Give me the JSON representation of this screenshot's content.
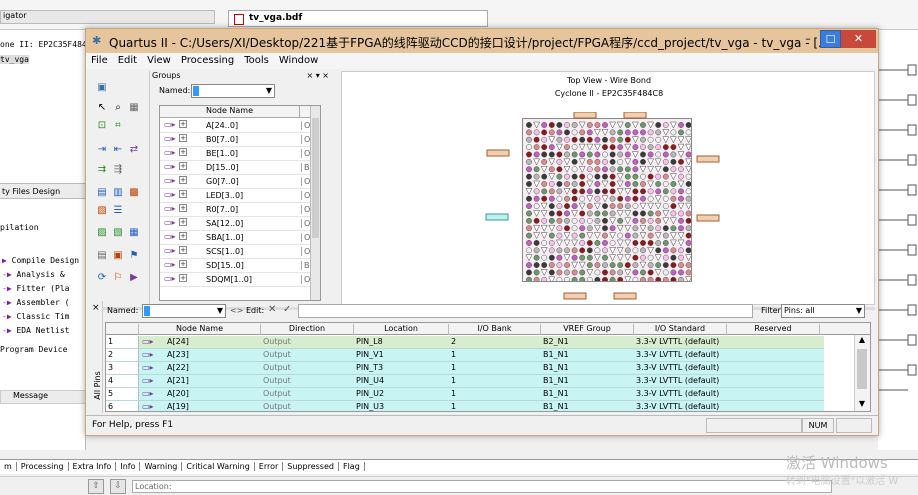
{
  "background": {
    "nav_header": "igator",
    "tab_file": "tv_vga.bdf",
    "hier_device": "one II: EP2C35F484",
    "hier_top": "tv_vga",
    "files_tab": "Files",
    "design_tab": "Design",
    "compilation": "pilation",
    "tasks": [
      "Compile Design",
      "Analysis &",
      "Fitter (Pla",
      "Assembler (",
      "Classic Tim",
      "EDA Netlist",
      "Program Device"
    ],
    "message_header": "Message",
    "bottom_tabs": [
      "m",
      "Processing",
      "Extra Info",
      "Info",
      "Warning",
      "Critical Warning",
      "Error",
      "Suppressed",
      "Flag"
    ],
    "location_label": "Location:",
    "watermark_line1": "激活 Windows",
    "watermark_line2": "转到\"电脑设置\"以激活 W"
  },
  "window": {
    "title": "Quartus II - C:/Users/XI/Desktop/221基于FPGA的线阵驱动CCD的接口设计/project/FPGA程序/ccd_project/tv_vga - tv_vga - [...",
    "min_label": "–",
    "max_label": "☐",
    "close_label": "✕",
    "menu": [
      "File",
      "Edit",
      "View",
      "Processing",
      "Tools",
      "Window"
    ]
  },
  "groups": {
    "header": "Groups",
    "header_buttons": "× ▾ ×",
    "named_label": "Named:",
    "column": "Node Name",
    "rows": [
      {
        "name": "A[24..0]",
        "dir": "Ou"
      },
      {
        "name": "B0[7..0]",
        "dir": "Ou"
      },
      {
        "name": "BE[1..0]",
        "dir": "Ou"
      },
      {
        "name": "D[15..0]",
        "dir": "Bic"
      },
      {
        "name": "G0[7..0]",
        "dir": "Ou"
      },
      {
        "name": "LED[3..0]",
        "dir": "Ou"
      },
      {
        "name": "R0[7..0]",
        "dir": "Ou"
      },
      {
        "name": "SA[12..0]",
        "dir": "Ou"
      },
      {
        "name": "SBA[1..0]",
        "dir": "Ou"
      },
      {
        "name": "SCS[1..0]",
        "dir": "Ou"
      },
      {
        "name": "SD[15..0]",
        "dir": "Bic"
      },
      {
        "name": "SDQM[1..0]",
        "dir": "Ou"
      }
    ]
  },
  "chip_view": {
    "title": "Top View - Wire Bond",
    "device": "Cyclone II - EP2C35F484C8"
  },
  "pin_planner": {
    "close": "×",
    "side_label": "All Pins",
    "named_label": "Named:",
    "edit_label": "Edit:",
    "filter_label": "Filter:",
    "filter_value": "Pins: all",
    "columns": [
      "Node Name",
      "Direction",
      "Location",
      "I/O Bank",
      "VREF Group",
      "I/O Standard",
      "Reserved"
    ],
    "rows": [
      {
        "num": "1",
        "node": "A[24]",
        "dir": "Output",
        "loc": "PIN_L8",
        "bank": "2",
        "vref": "B2_N1",
        "std": "3.3-V LVTTL (default)"
      },
      {
        "num": "2",
        "node": "A[23]",
        "dir": "Output",
        "loc": "PIN_V1",
        "bank": "1",
        "vref": "B1_N1",
        "std": "3.3-V LVTTL (default)"
      },
      {
        "num": "3",
        "node": "A[22]",
        "dir": "Output",
        "loc": "PIN_T3",
        "bank": "1",
        "vref": "B1_N1",
        "std": "3.3-V LVTTL (default)"
      },
      {
        "num": "4",
        "node": "A[21]",
        "dir": "Output",
        "loc": "PIN_U4",
        "bank": "1",
        "vref": "B1_N1",
        "std": "3.3-V LVTTL (default)"
      },
      {
        "num": "5",
        "node": "A[20]",
        "dir": "Output",
        "loc": "PIN_U2",
        "bank": "1",
        "vref": "B1_N1",
        "std": "3.3-V LVTTL (default)"
      },
      {
        "num": "6",
        "node": "A[19]",
        "dir": "Output",
        "loc": "PIN_U3",
        "bank": "1",
        "vref": "B1_N1",
        "std": "3.3-V LVTTL (default)"
      }
    ]
  },
  "status": {
    "help": "For Help, press F1",
    "num": "NUM"
  },
  "colors": {
    "titlebar": "#e6c59c",
    "maximize": "#3b7cdc",
    "close": "#c9483c",
    "row_teal": "#c8f4f4",
    "row_selected": "#d8ecd0"
  }
}
